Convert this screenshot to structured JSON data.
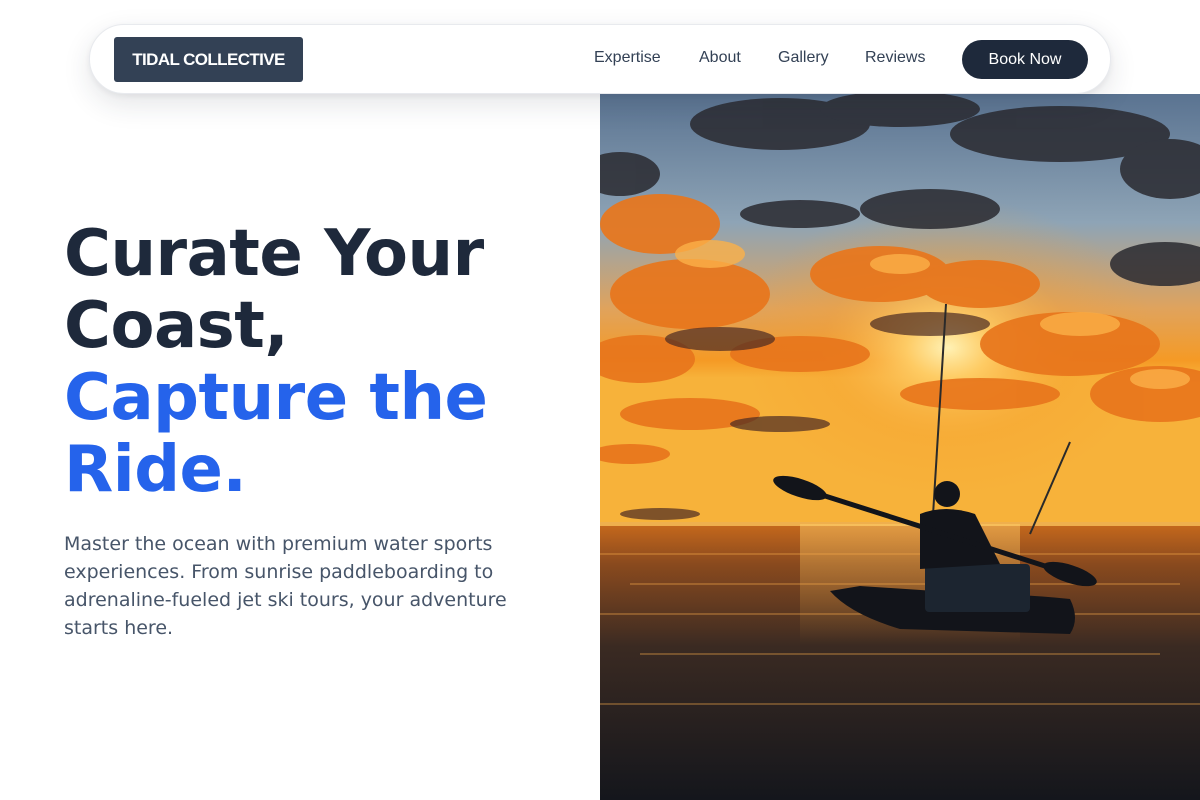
{
  "brand": {
    "name": "TIDAL COLLECTIVE"
  },
  "nav": {
    "links": [
      "Expertise",
      "About",
      "Gallery",
      "Reviews"
    ],
    "cta_label": "Book Now"
  },
  "hero": {
    "headline_line1": "Curate Your",
    "headline_line2": "Coast,",
    "headline_accent_line1": "Capture the",
    "headline_accent_line2": "Ride.",
    "subtitle": "Master the ocean with premium water sports experiences. From sunrise paddleboarding to adrenaline-fueled jet ski tours, your adventure starts here.",
    "image": "sunset-kayak-fishing-photo"
  },
  "colors": {
    "accent": "#2563eb",
    "dark": "#1e293b",
    "brand_bg": "#334155",
    "body_text": "#475569"
  }
}
